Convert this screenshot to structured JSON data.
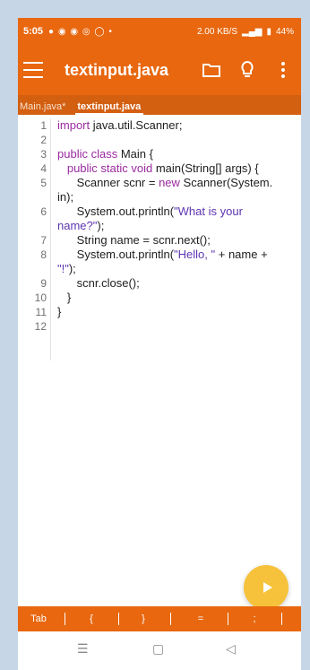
{
  "statusbar": {
    "time": "5:05",
    "left_icons": "● ◉ ◉ ◎ ◯ •",
    "speed": "2.00 KB/S",
    "battery": "44%"
  },
  "appbar": {
    "title": "textinput.java"
  },
  "tabs": [
    {
      "label": "Main.java*"
    },
    {
      "label": "textinput.java"
    }
  ],
  "editor": {
    "line_numbers": [
      "1",
      "2",
      "3",
      "4",
      "5",
      "",
      "6",
      "",
      "7",
      "8",
      "",
      "9",
      "10",
      "11",
      "12"
    ],
    "lines": [
      {
        "n": "1",
        "text": "import java.util.Scanner;"
      },
      {
        "n": "2",
        "text": ""
      },
      {
        "n": "3",
        "text": "public class Main {"
      },
      {
        "n": "4",
        "text": "   public static void main(String[] args) {"
      },
      {
        "n": "5",
        "text": "      Scanner scnr = new Scanner(System."
      },
      {
        "n": "",
        "text": "in);"
      },
      {
        "n": "6",
        "text": "      System.out.println(\"What is your"
      },
      {
        "n": "",
        "text": "name?\");"
      },
      {
        "n": "7",
        "text": "      String name = scnr.next();"
      },
      {
        "n": "8",
        "text": "      System.out.println(\"Hello, \" + name +"
      },
      {
        "n": "",
        "text": "\"!\");"
      },
      {
        "n": "9",
        "text": "      scnr.close();"
      },
      {
        "n": "10",
        "text": "   }"
      },
      {
        "n": "11",
        "text": "}"
      },
      {
        "n": "12",
        "text": ""
      }
    ]
  },
  "keys": [
    "Tab",
    "{",
    "}",
    "=",
    ";"
  ],
  "nav": {
    "menu": "☰",
    "home": "▢",
    "back": "◁"
  },
  "colors": {
    "accent": "#e8670f",
    "fab": "#f7c23b"
  }
}
